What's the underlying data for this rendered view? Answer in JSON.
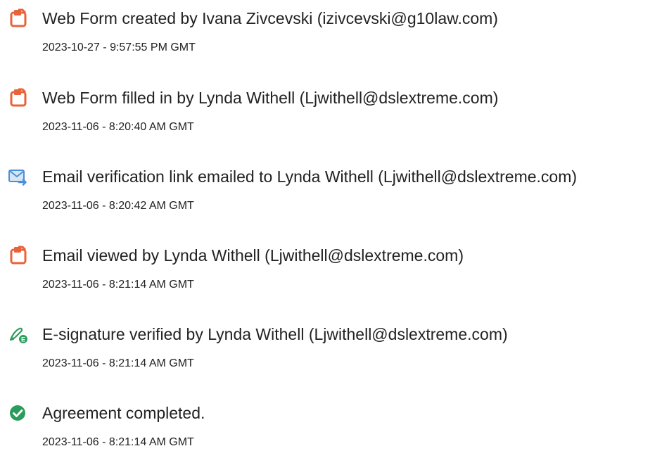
{
  "audit_trail": {
    "events": [
      {
        "icon": "document-create-icon",
        "title": "Web Form created by Ivana Zivcevski (izivcevski@g10law.com)",
        "timestamp": "2023-10-27 - 9:57:55 PM GMT"
      },
      {
        "icon": "document-create-icon",
        "title": "Web Form filled in by Lynda Withell (Ljwithell@dslextreme.com)",
        "timestamp": "2023-11-06 - 8:20:40 AM GMT"
      },
      {
        "icon": "email-send-icon",
        "title": "Email verification link emailed to Lynda Withell (Ljwithell@dslextreme.com)",
        "timestamp": "2023-11-06 - 8:20:42 AM GMT"
      },
      {
        "icon": "document-create-icon",
        "title": "Email viewed by Lynda Withell (Ljwithell@dslextreme.com)",
        "timestamp": "2023-11-06 - 8:21:14 AM GMT"
      },
      {
        "icon": "e-signature-icon",
        "title": "E-signature verified by Lynda Withell (Ljwithell@dslextreme.com)",
        "timestamp": "2023-11-06 - 8:21:14 AM GMT"
      },
      {
        "icon": "check-circle-icon",
        "title": "Agreement completed.",
        "timestamp": "2023-11-06 - 8:21:14 AM GMT"
      }
    ]
  },
  "colors": {
    "document_icon": "#e8633a",
    "email_icon": "#4a90d9",
    "signature_icon": "#2e9e5e",
    "check_icon": "#2a9d5c",
    "text": "#222222"
  }
}
